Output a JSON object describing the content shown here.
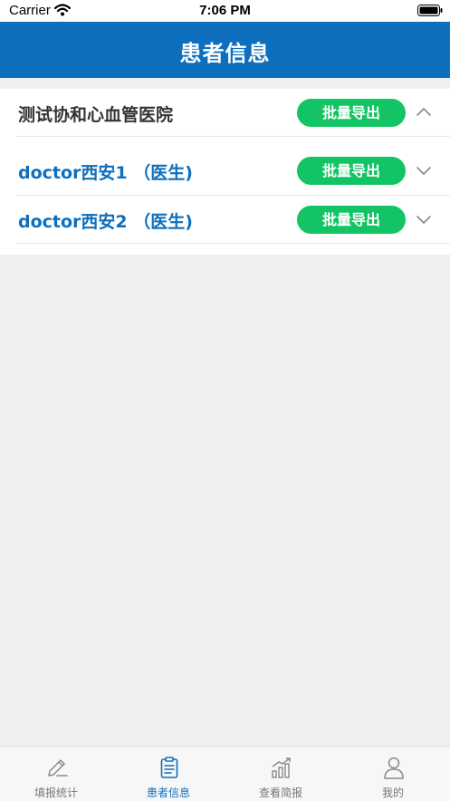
{
  "status_bar": {
    "carrier": "Carrier",
    "time": "7:06 PM"
  },
  "nav": {
    "title": "患者信息"
  },
  "hospital": {
    "name": "测试协和心血管医院",
    "export_label": "批量导出",
    "expanded": true
  },
  "doctors": [
    {
      "name": "doctor西安1 （医生)",
      "export_label": "批量导出",
      "expanded": false
    },
    {
      "name": "doctor西安2 （医生)",
      "export_label": "批量导出",
      "expanded": false
    }
  ],
  "tabs": [
    {
      "label": "填报统计",
      "icon": "pen-icon",
      "active": false
    },
    {
      "label": "患者信息",
      "icon": "clipboard-icon",
      "active": true
    },
    {
      "label": "查看简报",
      "icon": "chart-icon",
      "active": false
    },
    {
      "label": "我的",
      "icon": "person-icon",
      "active": false
    }
  ],
  "colors": {
    "brand": "#0d6fbd",
    "export_button": "#13c464",
    "background": "#f0f0f0"
  }
}
